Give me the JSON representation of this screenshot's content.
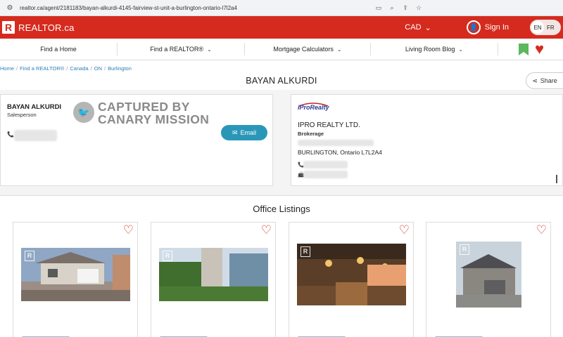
{
  "browser": {
    "url": "realtor.ca/agent/2181183/bayan-alkurdi-4145-fairview-st-unit-a-burlington-ontario-l7l2a4"
  },
  "header": {
    "logo_letter": "R",
    "logo_text": "REALTOR.ca",
    "currency": "CAD",
    "signin": "Sign In",
    "lang_en": "EN",
    "lang_fr": "FR",
    "accent": "#d52b1e"
  },
  "nav": {
    "items": [
      {
        "label": "Find a Home"
      },
      {
        "label": "Find a REALTOR®"
      },
      {
        "label": "Mortgage Calculators"
      },
      {
        "label": "Living Room Blog"
      }
    ]
  },
  "breadcrumb": [
    "Home",
    "Find a REALTOR®",
    "Canada",
    "ON",
    "Burlington"
  ],
  "agent": {
    "title": "BAYAN ALKURDI",
    "name": "BAYAN ALKURDI",
    "role": "Salesperson",
    "email_label": "Email",
    "share_label": "Share",
    "stamp_line1": "CAPTURED BY",
    "stamp_line2": "CANARY MISSION"
  },
  "brokerage": {
    "logo_text": "iProRealty",
    "name": "IPRO REALTY LTD.",
    "role": "Brokerage",
    "address": "BURLINGTON, Ontario L7L2A4"
  },
  "listings": {
    "title": "Office Listings",
    "cards": [
      {
        "id": 1
      },
      {
        "id": 2
      },
      {
        "id": 3
      },
      {
        "id": 4
      }
    ]
  }
}
